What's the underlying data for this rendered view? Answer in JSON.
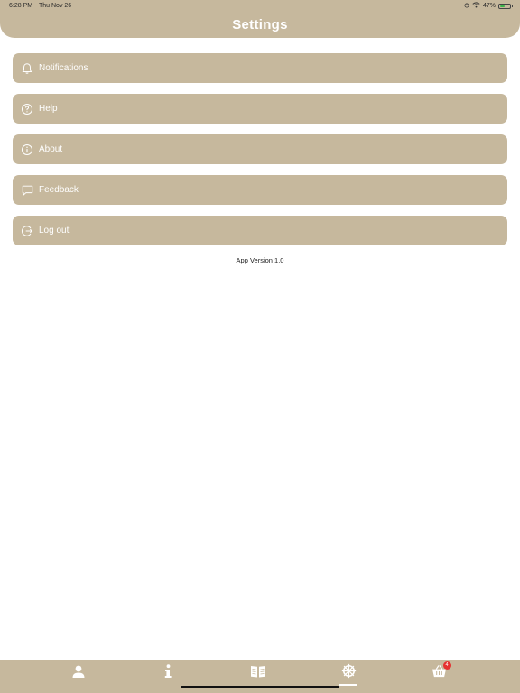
{
  "status_bar": {
    "time": "6:28 PM",
    "date": "Thu Nov 26",
    "battery": "47%",
    "battery_level": 0.47
  },
  "header": {
    "title": "Settings"
  },
  "menu": {
    "items": [
      {
        "label": "Notifications",
        "icon": "bell-icon"
      },
      {
        "label": "Help",
        "icon": "question-circle-icon"
      },
      {
        "label": "About",
        "icon": "info-circle-icon"
      },
      {
        "label": "Feedback",
        "icon": "chat-bubble-icon"
      },
      {
        "label": "Log out",
        "icon": "logout-icon"
      }
    ]
  },
  "footer": {
    "version": "App Version 1.0"
  },
  "tabbar": {
    "tabs": [
      {
        "icon": "person-icon"
      },
      {
        "icon": "info-icon"
      },
      {
        "icon": "book-icon"
      },
      {
        "icon": "settings-wheel-icon",
        "active": true
      },
      {
        "icon": "basket-icon",
        "badge": "4"
      }
    ]
  },
  "colors": {
    "accent": "#c6b89d",
    "badge": "#e53131",
    "text_on_accent": "#ffffff"
  }
}
